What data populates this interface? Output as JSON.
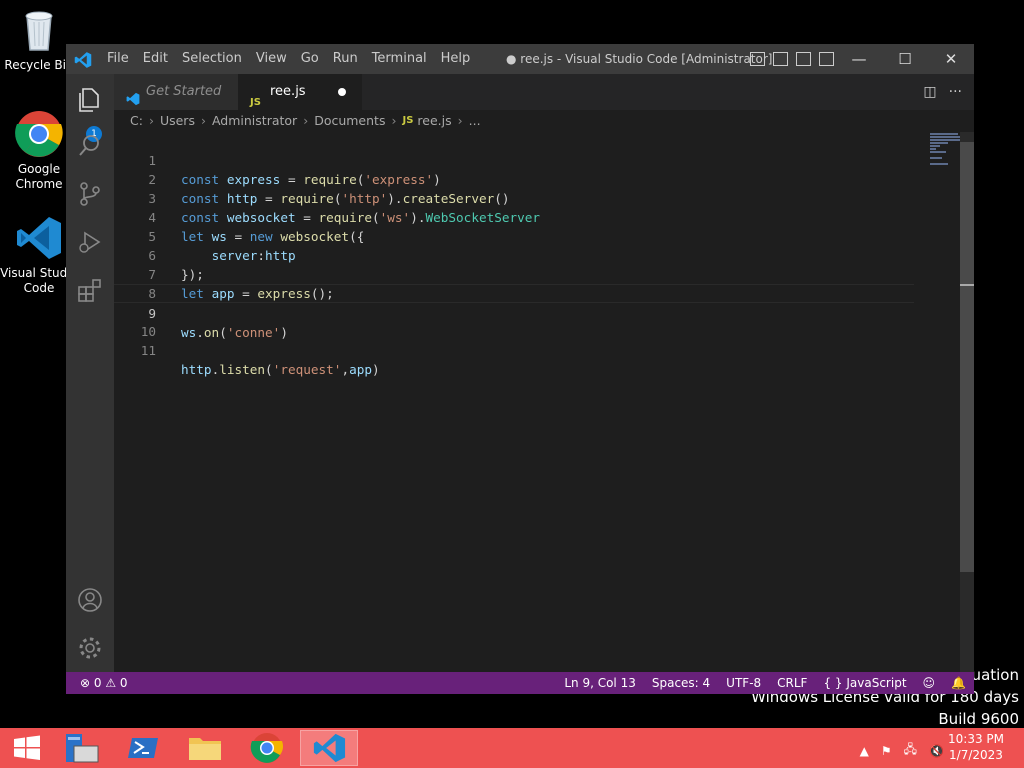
{
  "desktop": {
    "icons": [
      {
        "label": "Recycle Bin"
      },
      {
        "label": "Google Chrome"
      },
      {
        "label": "Visual Studio Code"
      }
    ],
    "watermark": [
      "luation",
      "Windows License valid for 180 days",
      "Build 9600"
    ]
  },
  "vscode": {
    "menu": [
      "File",
      "Edit",
      "Selection",
      "View",
      "Go",
      "Run",
      "Terminal",
      "Help"
    ],
    "title": "● ree.js - Visual Studio Code [Administrator]",
    "tabs": [
      {
        "label": "Get Started"
      },
      {
        "label": "ree.js",
        "dirty": true
      }
    ],
    "explorer_badge": "1",
    "breadcrumb": [
      "C:",
      "Users",
      "Administrator",
      "Documents",
      "ree.js",
      "..."
    ],
    "line_numbers": [
      "1",
      "2",
      "3",
      "4",
      "5",
      "6",
      "7",
      "8",
      "9",
      "10",
      "11"
    ],
    "statusbar": {
      "problems": "⊗ 0 ⚠ 0",
      "position": "Ln 9, Col 13",
      "spaces": "Spaces: 4",
      "encoding": "UTF-8",
      "eol": "CRLF",
      "language": "{ } JavaScript"
    },
    "colors": {
      "statusbar": "#68217a",
      "editor_bg": "#1e1e1e",
      "keyword": "#569cd6",
      "string": "#ce9178"
    }
  },
  "code": {
    "l1": {
      "kw": "const",
      "name": "express",
      "op": " = ",
      "fn": "require",
      "p1": "(",
      "str": "'express'",
      "p2": ")"
    },
    "l2": {
      "kw": "const",
      "name": "http",
      "op": " = ",
      "fn": "require",
      "p1": "(",
      "str": "'http'",
      "p2": ").",
      "fn2": "createServer",
      "p3": "()"
    },
    "l3": {
      "kw": "const",
      "name": "websocket",
      "op": " = ",
      "fn": "require",
      "p1": "(",
      "str": "'ws'",
      "p2": ").",
      "cls": "WebSocketServer"
    },
    "l4": {
      "kw": "let",
      "name": "ws",
      "op": " = ",
      "kw2": "new",
      "fn": "websocket",
      "p1": "({"
    },
    "l5": {
      "indent": "    ",
      "prop": "server",
      "colon": ":",
      "val": "http"
    },
    "l6": {
      "text": "});"
    },
    "l7": {
      "kw": "let",
      "name": "app",
      "op": " = ",
      "fn": "express",
      "p1": "();"
    },
    "l9": {
      "obj": "ws",
      "dot": ".",
      "fn": "on",
      "p1": "(",
      "str": "'conne'",
      "p2": ")"
    },
    "l11": {
      "obj": "http",
      "dot": ".",
      "fn": "listen",
      "p1": "(",
      "str": "'request'",
      "comma": ",",
      "arg": "app",
      "p2": ")"
    }
  },
  "taskbar": {
    "time": "10:33 PM",
    "date": "1/7/2023",
    "colors": {
      "bg": "#ee5151"
    }
  }
}
